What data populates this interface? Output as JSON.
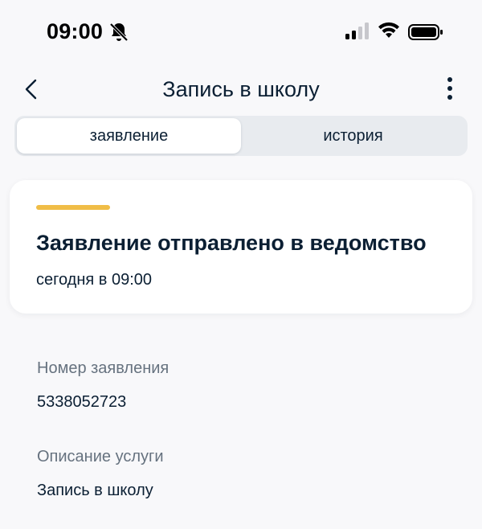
{
  "status_bar": {
    "time": "09:00",
    "icons": [
      "bell-slash-icon",
      "cellular-signal-icon",
      "wifi-icon",
      "battery-icon"
    ]
  },
  "nav": {
    "title": "Запись в школу",
    "back_icon": "chevron-left-icon",
    "more_icon": "more-vertical-icon"
  },
  "tabs": [
    {
      "label": "заявление",
      "active": true
    },
    {
      "label": "история",
      "active": false
    }
  ],
  "status_card": {
    "accent_color": "#f0bd47",
    "title": "Заявление отправлено в ведомство",
    "date": "сегодня в 09:00"
  },
  "fields": [
    {
      "label": "Номер заявления",
      "value": "5338052723"
    },
    {
      "label": "Описание услуги",
      "value": "Запись в школу"
    }
  ]
}
